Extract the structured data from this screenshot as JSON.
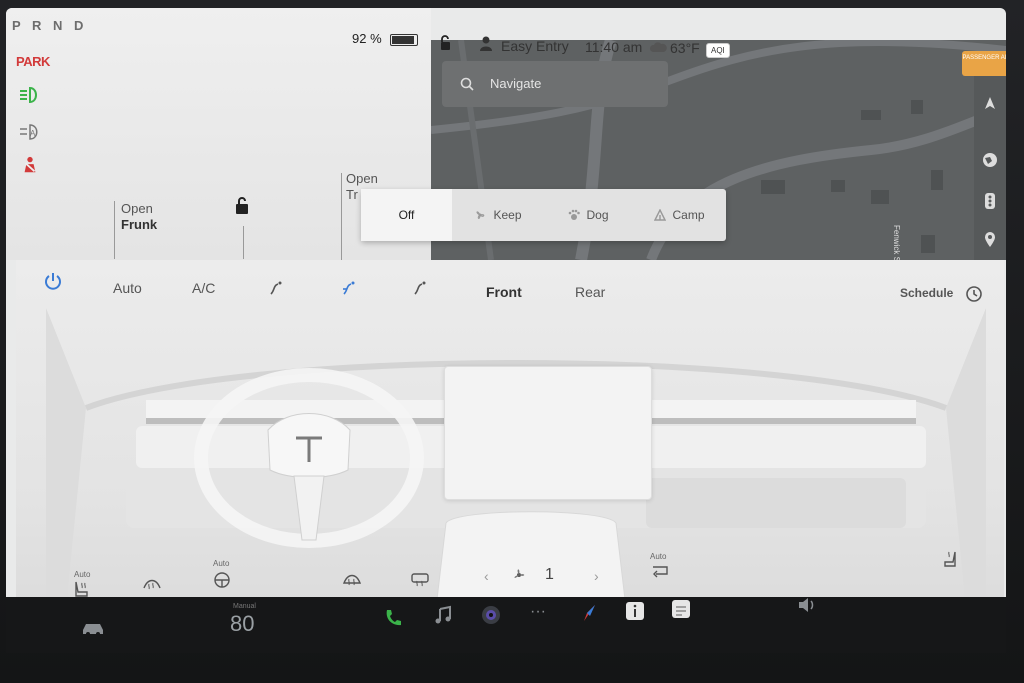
{
  "gear": "P R N D",
  "park_label": "PARK",
  "battery": {
    "percent_text": "92 %",
    "level": 0.92
  },
  "frunk": {
    "line1": "Open",
    "line2": "Frunk"
  },
  "trunk": {
    "line1": "Open",
    "line2": "Tr"
  },
  "status": {
    "profile": "Easy Entry",
    "time": "11:40 am",
    "temperature": "63°F",
    "aqi_label": "AQI"
  },
  "navigate_placeholder": "Navigate",
  "map": {
    "street_label": "Fenwick St"
  },
  "airbag_label": "PASSENGER AIRBAG",
  "keep_modes": [
    {
      "label": "Off",
      "active": true
    },
    {
      "label": "Keep",
      "active": false
    },
    {
      "label": "Dog",
      "active": false
    },
    {
      "label": "Camp",
      "active": false
    }
  ],
  "climate": {
    "auto": "Auto",
    "ac": "A/C",
    "front": "Front",
    "rear": "Rear",
    "schedule": "Schedule",
    "fan_speed": "1",
    "seat_auto_left": "Auto",
    "wheel_auto": "Auto",
    "recirc_auto": "Auto"
  },
  "dock": {
    "speed": "80",
    "speed_mode": "Manual"
  },
  "colors": {
    "park": "#d23a3a",
    "lights": "#3bb34a",
    "seatbelt": "#d23a3a",
    "power": "#3a7bd5",
    "airbag": "#e9a446"
  }
}
